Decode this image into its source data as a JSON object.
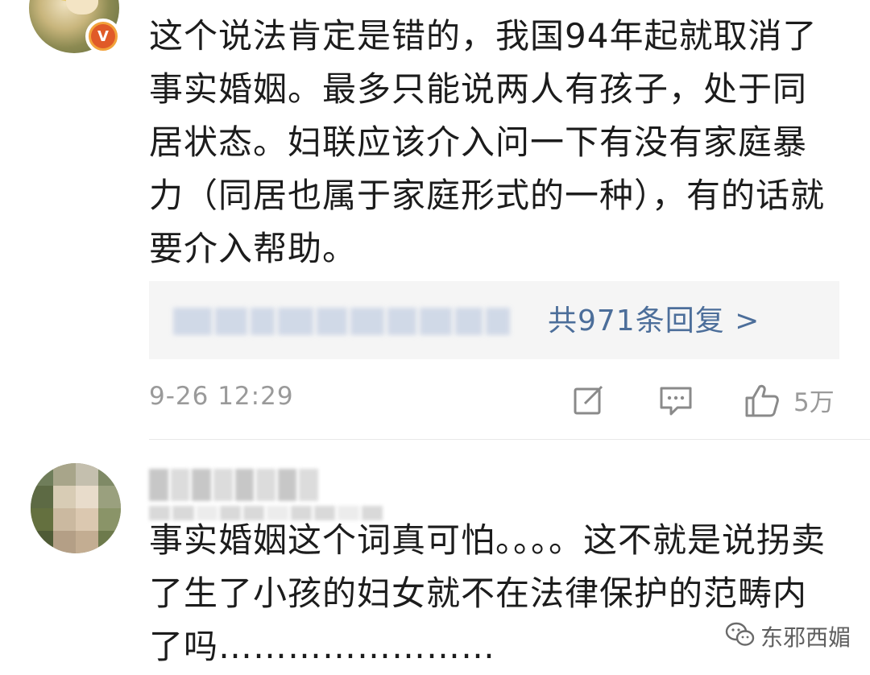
{
  "comments": [
    {
      "verified_badge": "V",
      "text": "这个说法肯定是错的，我国94年起就取消了事实婚姻。最多只能说两人有孩子，处于同居状态。妇联应该介入问一下有没有家庭暴力（同居也属于家庭形式的一种），有的话就要介入帮助。",
      "replies_link": "共971条回复 >",
      "timestamp": "9-26 12:29",
      "like_count": "5万",
      "icons": [
        "edit-repost-icon",
        "comment-icon",
        "thumbs-up-icon"
      ]
    },
    {
      "text": "事实婚姻这个词真可怕。。。。这不就是说拐卖了生了小孩的妇女就不在法律保护的范畴内了吗……………………"
    }
  ],
  "watermark": {
    "icon": "wechat-icon",
    "text": "东邪西媚"
  },
  "colors": {
    "link": "#4c6e9a",
    "meta_gray": "#9a9a9a",
    "reply_box_bg": "#f5f5f5",
    "badge_orange": "#f2a23a"
  }
}
